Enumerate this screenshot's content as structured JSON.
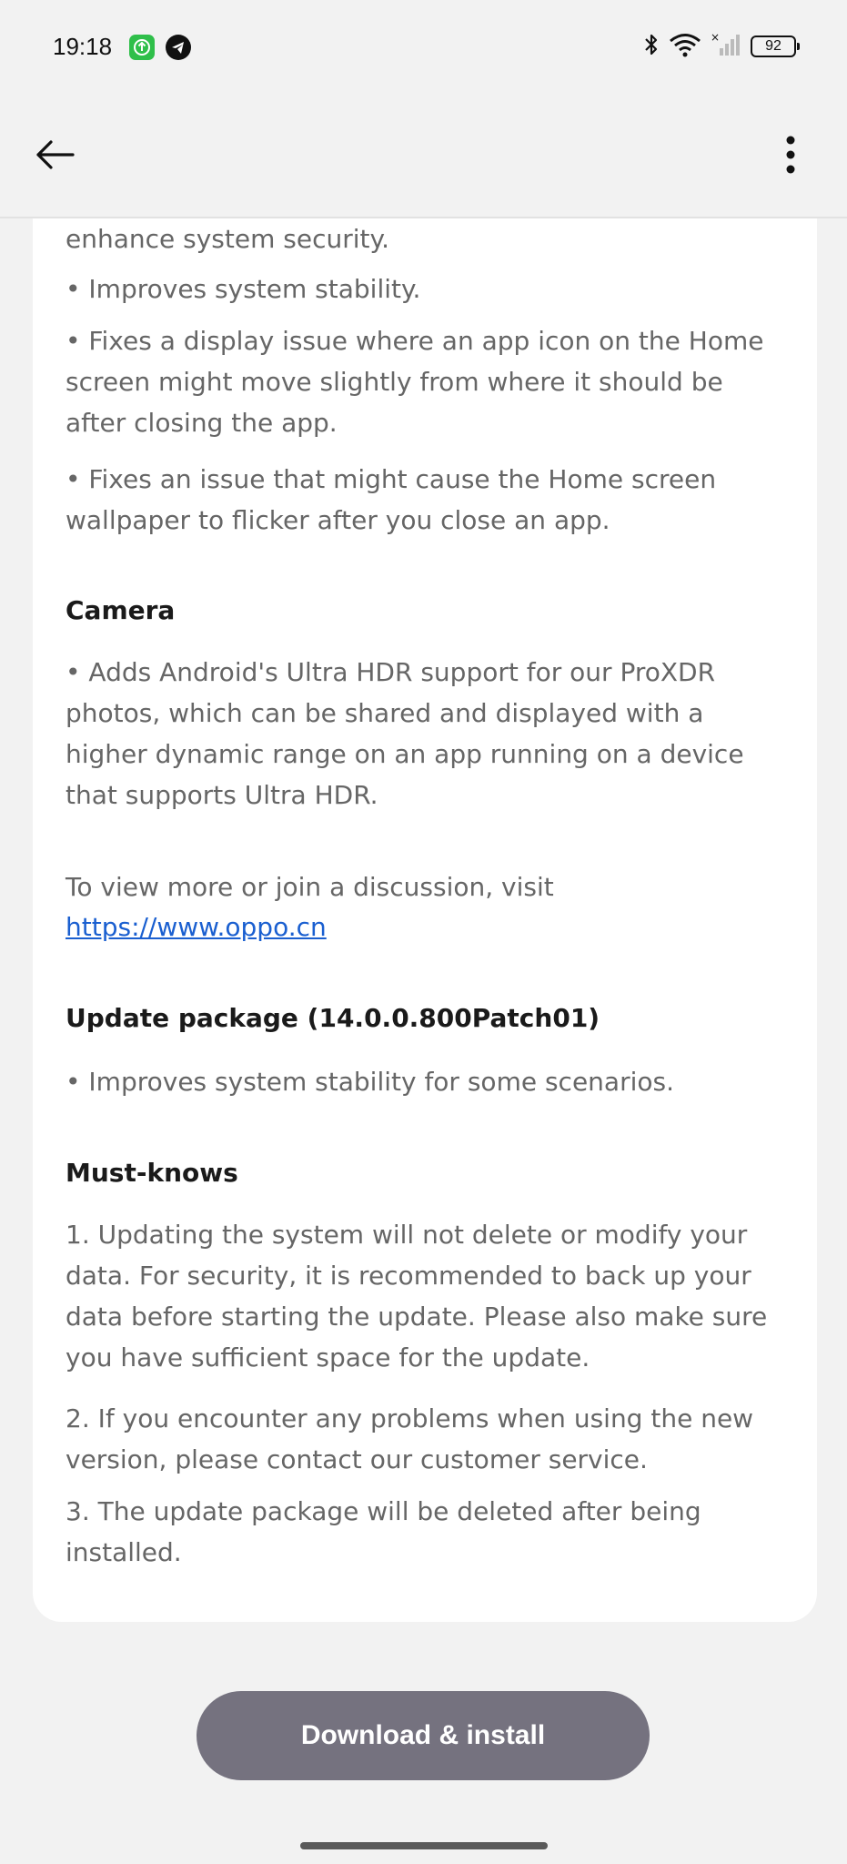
{
  "status": {
    "time": "19:18",
    "battery": "92"
  },
  "sections": [
    {
      "type": "para",
      "text": "enhance system security."
    },
    {
      "type": "para",
      "text": "• Improves system stability."
    },
    {
      "type": "para",
      "text": "• Fixes a display issue where an app icon on the Home screen might move slightly from where it should be after closing the app."
    },
    {
      "type": "para",
      "text": "• Fixes an issue that might cause the Home screen wallpaper to flicker after you close an app."
    },
    {
      "type": "heading",
      "text": "Camera"
    },
    {
      "type": "para",
      "text": "• Adds Android's Ultra HDR support for our ProXDR photos, which can be shared and displayed with a higher dynamic range on an app running on a device that supports Ultra HDR."
    },
    {
      "type": "para",
      "text": "To view more or join a discussion, visit"
    },
    {
      "type": "link",
      "text": "https://www.oppo.cn"
    },
    {
      "type": "heading",
      "text": "Update package (14.0.0.800Patch01)"
    },
    {
      "type": "para",
      "text": "• Improves system stability for some scenarios."
    },
    {
      "type": "heading",
      "text": "Must-knows"
    },
    {
      "type": "para",
      "text": "1. Updating the system will not delete or modify your data. For security, it is recommended to back up your data before starting the update. Please also make sure you have sufficient space for the update."
    },
    {
      "type": "para",
      "text": "2. If you encounter any problems when using the new version, please contact our customer service."
    },
    {
      "type": "para",
      "text": "3. The update package will be deleted after being installed."
    }
  ],
  "actions": {
    "download_install": "Download & install"
  }
}
